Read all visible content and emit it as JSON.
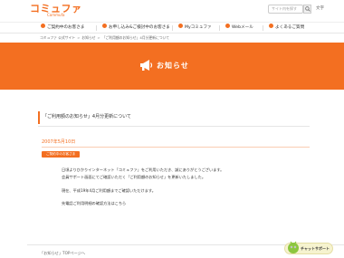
{
  "header": {
    "logo_main": "コミュファ",
    "logo_sub": "Commufa",
    "search_placeholder": "サイト内を探す",
    "links": [
      "文字"
    ]
  },
  "nav": {
    "items": [
      {
        "label": "ご契約中のお客さま"
      },
      {
        "label": "お申し込み&ご検討中のお客さま"
      },
      {
        "label": "Myコミュファ"
      },
      {
        "label": "Webメール"
      },
      {
        "label": "よくあるご質問"
      }
    ]
  },
  "breadcrumb": [
    "コミュファ 公式サイト",
    "お知らせ",
    "「ご利用額のお知らせ」4月分更新について"
  ],
  "banner": {
    "title": "お知らせ"
  },
  "notice": {
    "title": "「ご利用額のお知らせ」4月分更新について",
    "date": "2007年5月10日",
    "tag": "ご契約中のお客さま",
    "paragraphs": [
      "日頃よりひかりインターネット「コミュファ」をご利用いただき、誠にありがとうございます。",
      "会員サポート画面にてご確認いただく「ご利用額のお知らせ」を更新いたしました。",
      "現在、平成19年4月ご利用額までご確認いただけます。",
      "先電話ご利用明細の確認方法はこちら"
    ]
  },
  "footer": {
    "back_link": "「お知らせ」TOPページへ"
  },
  "chat": {
    "label": "チャットサポート"
  },
  "colors": {
    "brand": "#f36f21"
  }
}
